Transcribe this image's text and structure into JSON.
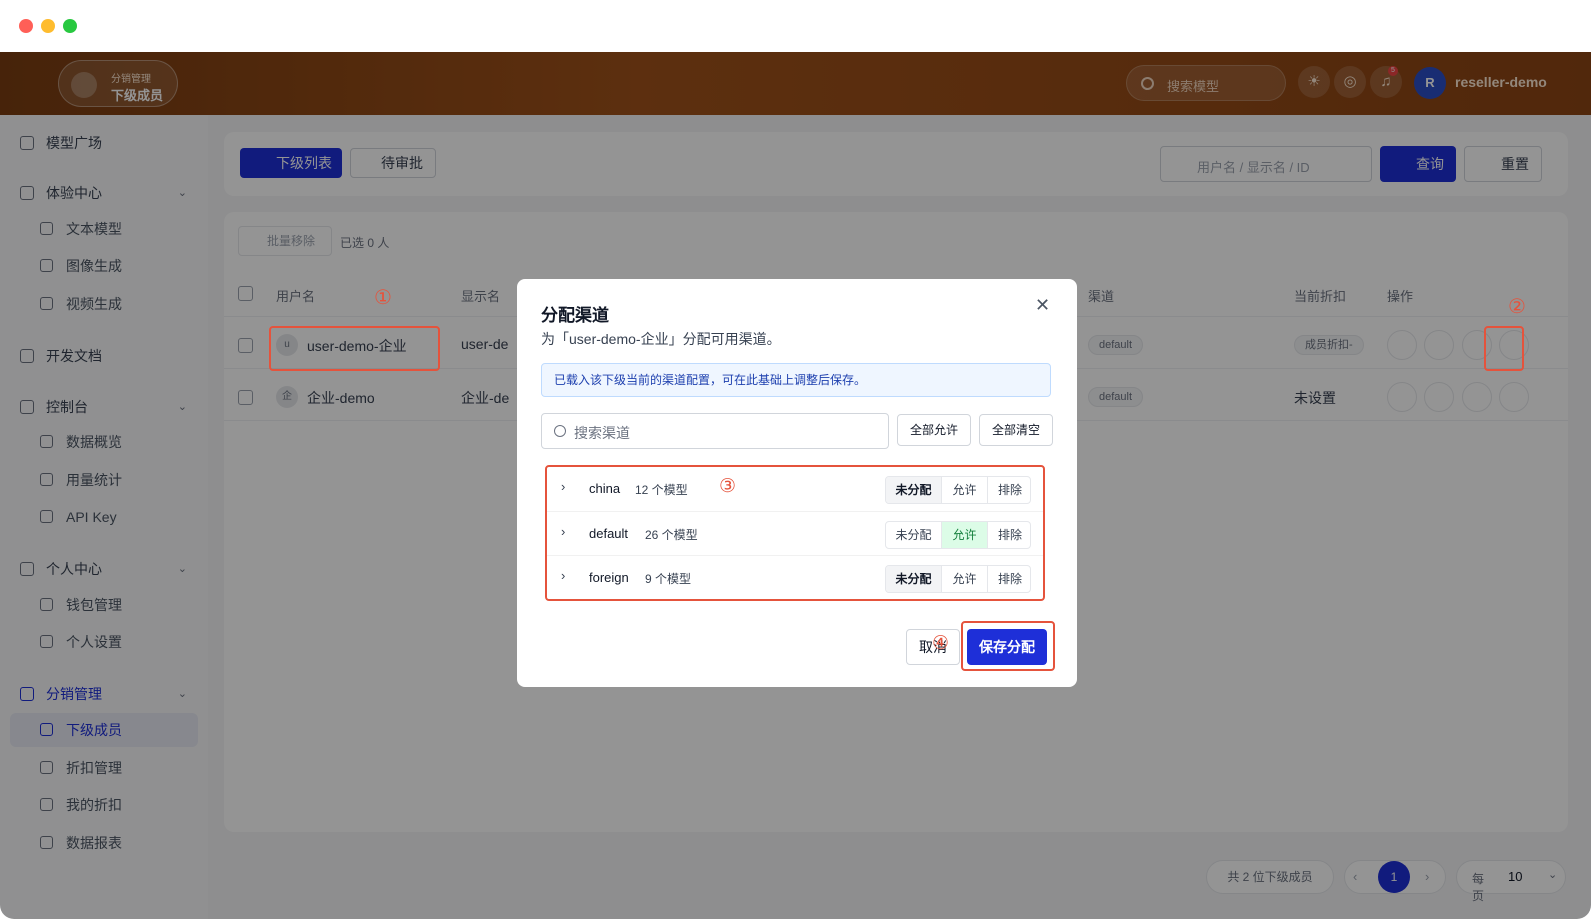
{
  "header": {
    "logo_sub": "分销管理",
    "logo_title": "下级成员",
    "search_placeholder": "搜索模型",
    "notification_count": "5",
    "avatar_letter": "R",
    "username": "reseller-demo"
  },
  "sidebar": {
    "groups": [
      {
        "label": "模型广场"
      },
      {
        "label": "体验中心",
        "items": [
          "文本模型",
          "图像生成",
          "视频生成"
        ]
      },
      {
        "label": "开发文档"
      },
      {
        "label": "控制台",
        "items": [
          "数据概览",
          "用量统计",
          "API Key"
        ]
      },
      {
        "label": "个人中心",
        "items": [
          "钱包管理",
          "个人设置"
        ]
      },
      {
        "label": "分销管理",
        "items": [
          "下级成员",
          "折扣管理",
          "我的折扣",
          "数据报表"
        ]
      }
    ],
    "active_item": "下级成员"
  },
  "toolbar": {
    "tab_members": "下级列表",
    "tab_pending": "待审批",
    "search_placeholder": "用户名 / 显示名 / ID",
    "query_button": "查询",
    "reset_button": "重置"
  },
  "table": {
    "bulk_remove": "批量移除",
    "selected_count": "已选 0 人",
    "headers": {
      "username": "用户名",
      "display_name": "显示名",
      "channel": "渠道",
      "discount": "当前折扣",
      "actions": "操作"
    },
    "rows": [
      {
        "avatar": "u",
        "username": "user-demo-企业",
        "display_name": "user-de",
        "channel": "default",
        "discount": "成员折扣-"
      },
      {
        "avatar": "企",
        "username": "企业-demo",
        "display_name": "企业-de",
        "channel": "default",
        "discount": "未设置"
      }
    ]
  },
  "pagination": {
    "total": "共 2 位下级成员",
    "current_page": "1",
    "page_size_label": "每页",
    "page_size": "10"
  },
  "annotations": {
    "n1": "①",
    "n2": "②",
    "n3": "③",
    "n4": "④"
  },
  "modal": {
    "title": "分配渠道",
    "subtitle": "为「user-demo-企业」分配可用渠道。",
    "info": "已载入该下级当前的渠道配置，可在此基础上调整后保存。",
    "search_placeholder": "搜索渠道",
    "allow_all": "全部允许",
    "clear_all": "全部清空",
    "option_labels": {
      "unassigned": "未分配",
      "allow": "允许",
      "exclude": "排除"
    },
    "channels": [
      {
        "name": "china",
        "count": "12 个模型",
        "state": "unassigned"
      },
      {
        "name": "default",
        "count": "26 个模型",
        "state": "allow"
      },
      {
        "name": "foreign",
        "count": "9 个模型",
        "state": "unassigned"
      }
    ],
    "cancel": "取消",
    "save": "保存分配"
  }
}
